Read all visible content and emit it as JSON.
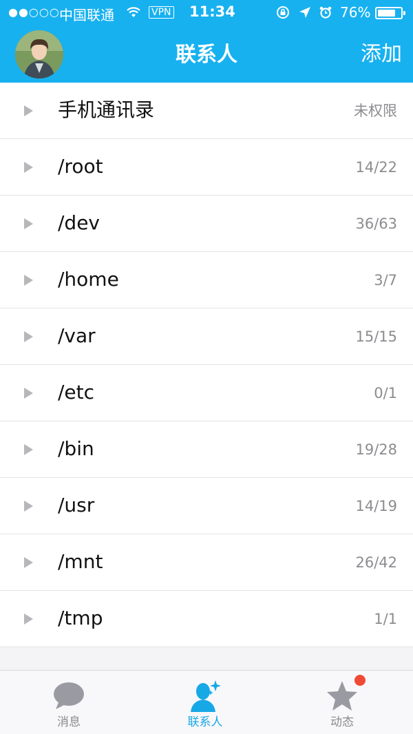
{
  "status_bar": {
    "signal": "●●○○○",
    "carrier": "中国联通",
    "vpn": "VPN",
    "time": "11:34",
    "battery": "76%",
    "battery_level": 0.76
  },
  "header": {
    "title": "联系人",
    "add_label": "添加",
    "color": "#17b1f0"
  },
  "groups": [
    {
      "name": "手机通讯录",
      "count": "未权限"
    },
    {
      "name": "/root",
      "count": "14/22"
    },
    {
      "name": "/dev",
      "count": "36/63"
    },
    {
      "name": "/home",
      "count": "3/7"
    },
    {
      "name": "/var",
      "count": "15/15"
    },
    {
      "name": "/etc",
      "count": "0/1"
    },
    {
      "name": "/bin",
      "count": "19/28"
    },
    {
      "name": "/usr",
      "count": "14/19"
    },
    {
      "name": "/mnt",
      "count": "26/42"
    },
    {
      "name": "/tmp",
      "count": "1/1"
    }
  ],
  "tabbar": {
    "tabs": [
      {
        "label": "消息",
        "icon": "chat-bubble-icon"
      },
      {
        "label": "联系人",
        "icon": "contacts-icon",
        "active": true
      },
      {
        "label": "动态",
        "icon": "star-icon",
        "badge": true
      }
    ]
  }
}
